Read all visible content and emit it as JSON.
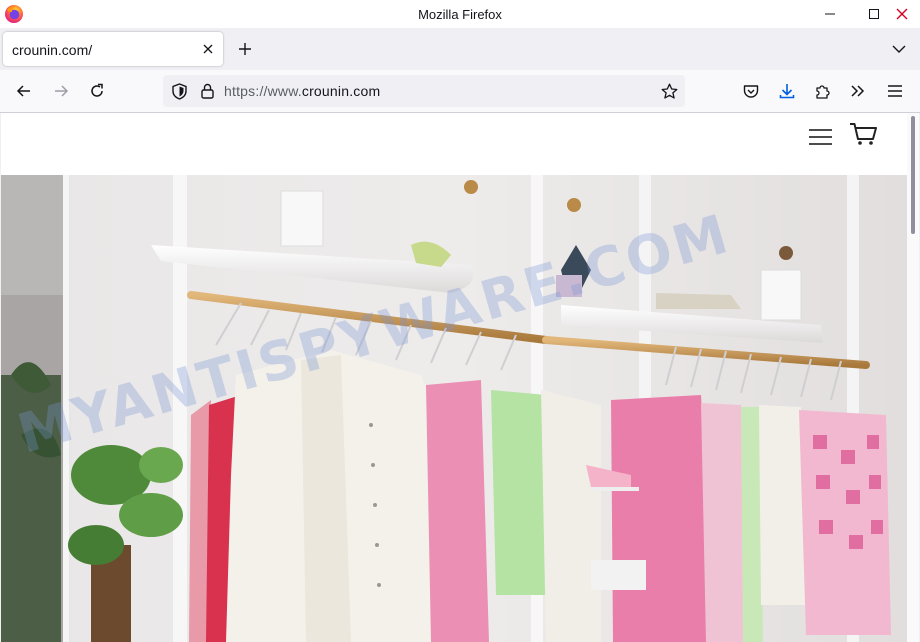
{
  "window": {
    "title": "Mozilla Firefox"
  },
  "tab": {
    "title": "crounin.com/"
  },
  "urlbar": {
    "prefix": "https://www.",
    "domain": "crounin.com"
  },
  "icons": {
    "app": "firefox-logo",
    "minimize": "minimize-icon",
    "maximize": "maximize-icon",
    "close": "close-icon",
    "tab_close": "close-icon",
    "new_tab": "plus-icon",
    "tab_list": "chevron-down-icon",
    "back": "arrow-left-icon",
    "forward": "arrow-right-icon",
    "reload": "reload-icon",
    "tracking": "shield-icon",
    "lock": "lock-icon",
    "bookmark": "star-icon",
    "pocket": "pocket-icon",
    "downloads": "download-icon",
    "extensions": "puzzle-icon",
    "overflow": "double-chevron-icon",
    "menu": "hamburger-icon",
    "site_menu": "hamburger-icon",
    "site_cart": "cart-icon"
  },
  "colors": {
    "accent": "#0060df",
    "close_red": "#d70022",
    "watermark": "#7896d2"
  },
  "watermark": {
    "text": "MYANTISPYWARE.COM"
  }
}
